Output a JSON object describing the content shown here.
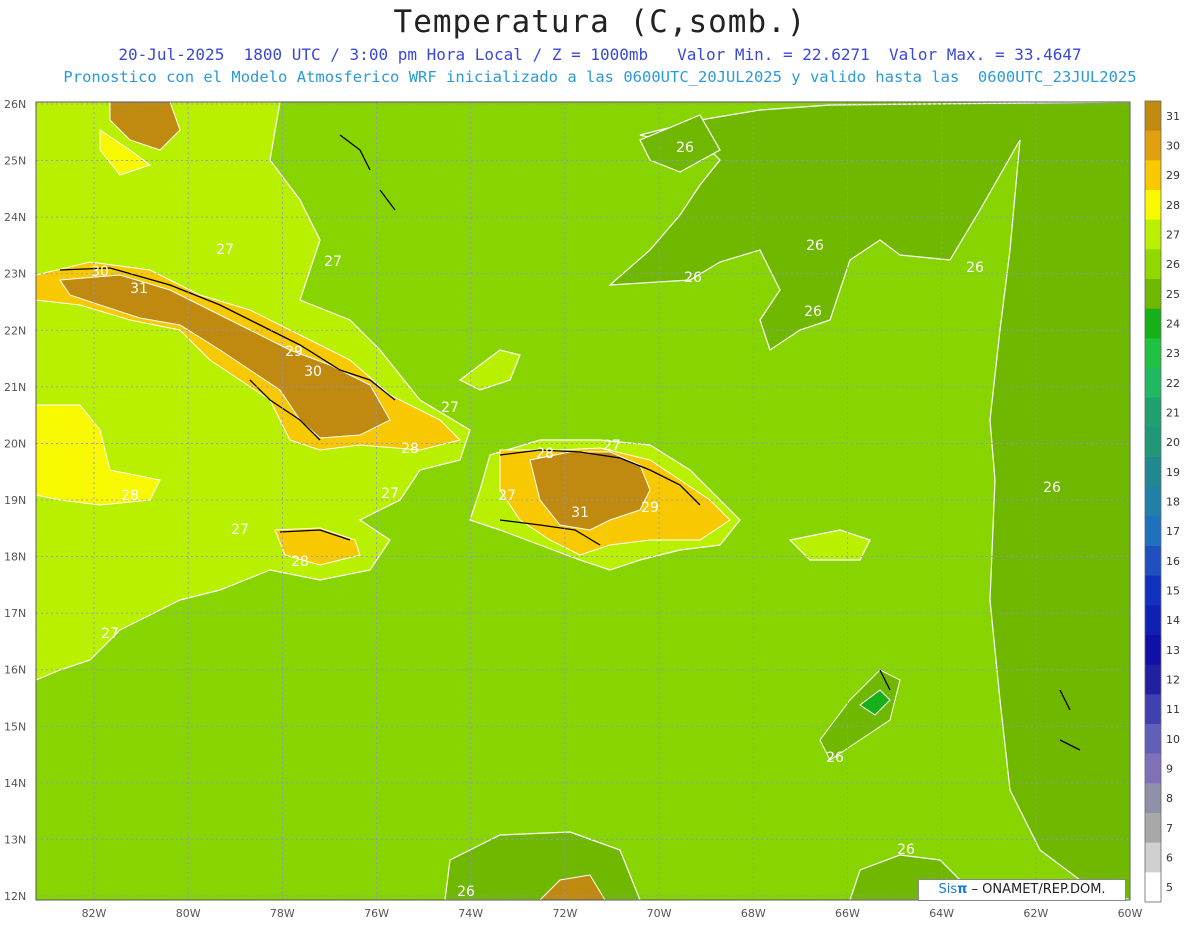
{
  "header": {
    "title": "Temperatura (C,somb.)",
    "line1": "20-Jul-2025  1800 UTC / 3:00 pm Hora Local / Z = 1000mb   Valor Min. = 22.6271  Valor Max. = 33.4647",
    "line2": "Pronostico con el Modelo Atmosferico WRF inicializado a las 0600UTC_20JUL2025 y valido hasta las  0600UTC_23JUL2025"
  },
  "credit": {
    "brand": "Sis",
    "pi": "π",
    "rest": " – ONAMET/REP.DOM."
  },
  "axes": {
    "lat_labels": [
      "26N",
      "25N",
      "24N",
      "23N",
      "22N",
      "21N",
      "20N",
      "19N",
      "18N",
      "17N",
      "16N",
      "15N",
      "14N",
      "13N",
      "12N"
    ],
    "lon_labels": [
      "82W",
      "80W",
      "78W",
      "76W",
      "74W",
      "72W",
      "70W",
      "68W",
      "66W",
      "64W",
      "62W",
      "60W"
    ]
  },
  "colorbar": {
    "labels": [
      "31",
      "30",
      "29",
      "28",
      "27",
      "26",
      "25",
      "24",
      "23",
      "22",
      "21",
      "20",
      "19",
      "18",
      "17",
      "16",
      "15",
      "14",
      "13",
      "12",
      "11",
      "10",
      "9",
      "8",
      "7",
      "6",
      "5"
    ],
    "colors": [
      "#c08a10",
      "#e0a010",
      "#f8c800",
      "#f8f800",
      "#b8f000",
      "#90d800",
      "#70b800",
      "#18b018",
      "#20c040",
      "#20b860",
      "#20a070",
      "#209878",
      "#208890",
      "#2080a8",
      "#2070c0",
      "#2050c0",
      "#1030c0",
      "#1020b0",
      "#1010a8",
      "#2020a0",
      "#4040b0",
      "#6060b8",
      "#8070b8",
      "#9090a8",
      "#a8a8a8",
      "#d0d0d0",
      "#ffffff"
    ]
  },
  "map": {
    "background_color": "#88d400",
    "contour_labels": [
      "26",
      "26",
      "26",
      "26",
      "26",
      "26",
      "26",
      "26",
      "26",
      "27",
      "27",
      "27",
      "27",
      "27",
      "27",
      "27",
      "27",
      "28",
      "28",
      "28",
      "28",
      "29",
      "29",
      "30",
      "30",
      "31",
      "31"
    ]
  }
}
